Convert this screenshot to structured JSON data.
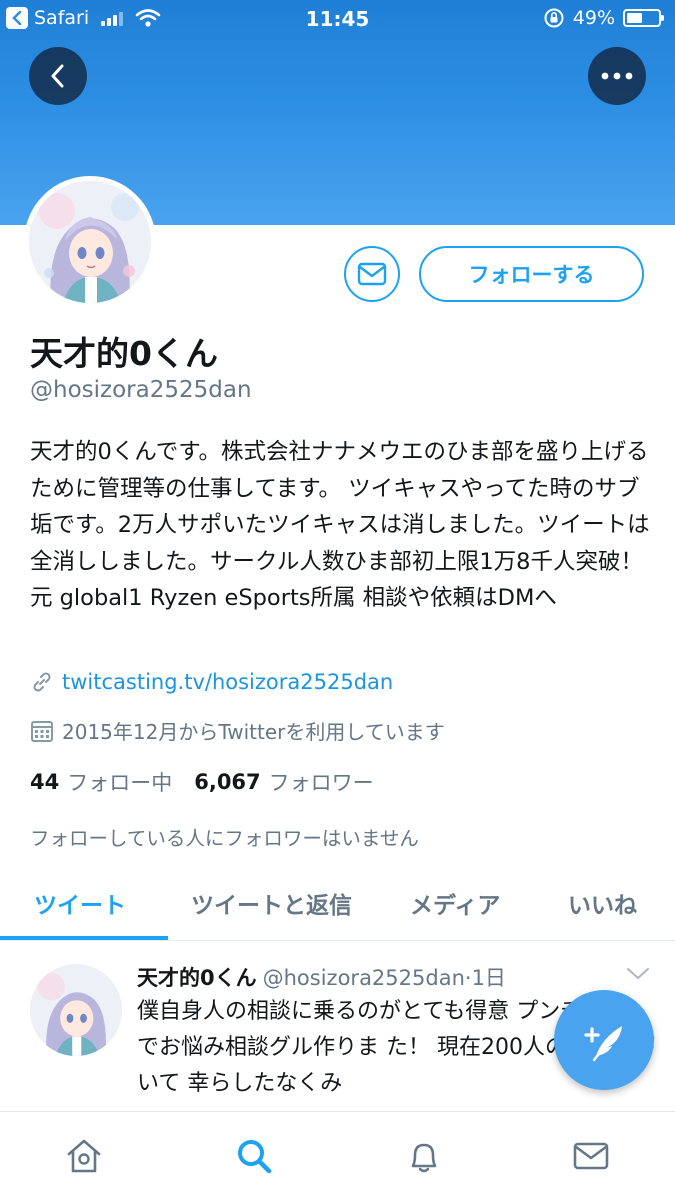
{
  "status_bar": {
    "app": "Safari",
    "time": "11:45",
    "battery": "49%",
    "battery_level": 0.49
  },
  "profile": {
    "display_name": "天才的0くん",
    "handle": "@hosizora2525dan",
    "bio": "天才的0くんです。株式会社ナナメウエのひま部を盛り上げるために管理等の仕事してます。 ツイキャスやってた時のサブ垢です。2万人サポいたツイキャスは消しました。ツイートは全消ししました。サークル人数ひま部初上限1万8千人突破！元 global1 Ryzen eSports所属 相談や依頼はDMへ",
    "link": "twitcasting.tv/hosizora2525dan",
    "joined": "2015年12月からTwitterを利用しています",
    "following_count": "44",
    "following_label": "フォロー中",
    "followers_count": "6,067",
    "followers_label": "フォロワー",
    "follower_note": "フォローしている人にフォロワーはいません",
    "follow_button": "フォローする"
  },
  "tabs": [
    {
      "label": "ツイート"
    },
    {
      "label": "ツイートと返信"
    },
    {
      "label": "メディア"
    },
    {
      "label": "いいね"
    }
  ],
  "tweet": {
    "name": "天才的0くん",
    "handle": "@hosizora2525dan",
    "time": "·1日",
    "text": "僕自身人の相談に乗るのがとても得意 プンチャット でお悩み相談グル作りま た！ 現在200人の参加者がいて 幸らしたなくみ"
  },
  "icons": {
    "back": "back-arrow-icon",
    "more": "more-dots-icon",
    "message": "envelope-icon",
    "link": "link-icon",
    "calendar": "calendar-icon",
    "chevron": "chevron-down-icon",
    "compose": "compose-feather-icon",
    "home": "home-icon",
    "search": "search-icon",
    "notifications": "bell-icon",
    "messages": "mail-icon"
  },
  "colors": {
    "accent": "#1da1f2",
    "banner": "#2d8fe3",
    "muted": "#657786"
  }
}
